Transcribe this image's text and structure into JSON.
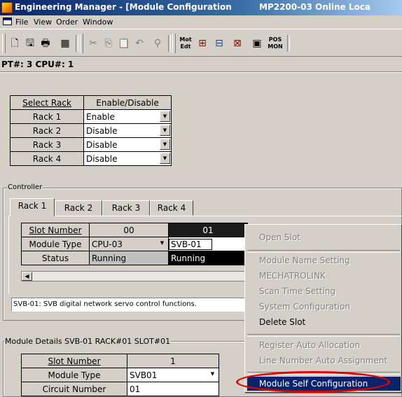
{
  "window": {
    "title": "Engineering Manager - [Module Configuration",
    "title_right": "MP2200-03 Online Loca"
  },
  "menu": [
    "File",
    "View",
    "Order",
    "Window"
  ],
  "toolbar": {
    "icons": [
      "new-icon",
      "save-icon",
      "print-icon",
      "network-icon",
      "cut-icon",
      "copy-icon",
      "paste-icon",
      "undo-icon",
      "find-icon",
      "mot-edit-icon",
      "ladder-icon",
      "ladder-hash-icon",
      "chart-icon",
      "properties-icon",
      "pos-mon-icon"
    ],
    "mot_edt": "Mot\nEdt",
    "pos_mon": "POS\nMON"
  },
  "pt_line": "PT#: 3 CPU#: 1",
  "rack_table": {
    "headers": [
      "Select Rack",
      "Enable/Disable"
    ],
    "rows": [
      {
        "rack": "Rack 1",
        "value": "Enable"
      },
      {
        "rack": "Rack 2",
        "value": "Disable"
      },
      {
        "rack": "Rack 3",
        "value": "Disable"
      },
      {
        "rack": "Rack 4",
        "value": "Disable"
      }
    ]
  },
  "controller": {
    "label": "Controller",
    "tabs": [
      "Rack 1",
      "Rack 2",
      "Rack 3",
      "Rack 4"
    ],
    "active_tab": 0,
    "slot_table": {
      "row_labels": [
        "Slot Number",
        "Module Type",
        "Status"
      ],
      "slots": [
        {
          "number": "00",
          "type": "CPU-03",
          "status": "Running"
        },
        {
          "number": "01",
          "type": "SVB-01",
          "status": "Running"
        }
      ]
    },
    "description": "SVB-01: SVB digital network servo control functions."
  },
  "module_details": {
    "label": "Module Details  SVB-01  RACK#01  SLOT#01",
    "rows": [
      {
        "label": "Slot Number",
        "value": "1"
      },
      {
        "label": "Module Type",
        "value": "SVB01"
      },
      {
        "label": "Circuit Number",
        "value": "01"
      }
    ]
  },
  "context_menu": {
    "items": [
      {
        "label": "Open Slot",
        "enabled": false
      },
      {
        "label": "Module Name Setting",
        "enabled": false
      },
      {
        "label": "MECHATROLINK",
        "enabled": false
      },
      {
        "label": "Scan Time Setting",
        "enabled": false
      },
      {
        "label": "System Configuration",
        "enabled": false
      },
      {
        "label": "Delete Slot",
        "enabled": true
      },
      {
        "label": "Register Auto Allocation",
        "enabled": false
      },
      {
        "label": "Line Number Auto Assignment",
        "enabled": false
      },
      {
        "label": "Module Self Configuration",
        "enabled": true,
        "highlighted": true
      }
    ]
  },
  "colors": {
    "title_gradient_start": "#0a246a",
    "highlight": "#0a246a",
    "annotation": "#e00000"
  }
}
